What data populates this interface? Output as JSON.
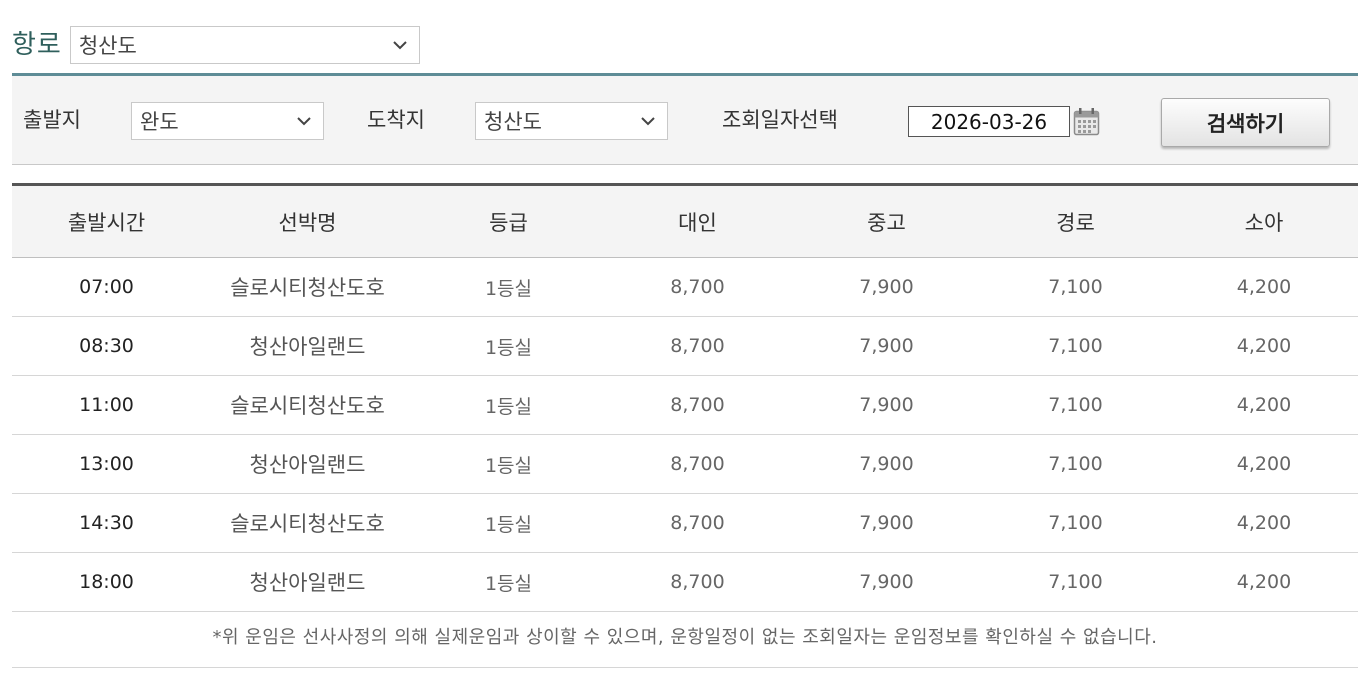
{
  "route": {
    "label": "항로",
    "selected": "청산도"
  },
  "search": {
    "departure_label": "출발지",
    "departure_value": "완도",
    "arrival_label": "도착지",
    "arrival_value": "청산도",
    "date_label": "조회일자선택",
    "date_value": "2026-03-26",
    "button_label": "검색하기"
  },
  "table": {
    "headers": [
      "출발시간",
      "선박명",
      "등급",
      "대인",
      "중고",
      "경로",
      "소아"
    ],
    "rows": [
      [
        "07:00",
        "슬로시티청산도호",
        "1등실",
        "8,700",
        "7,900",
        "7,100",
        "4,200"
      ],
      [
        "08:30",
        "청산아일랜드",
        "1등실",
        "8,700",
        "7,900",
        "7,100",
        "4,200"
      ],
      [
        "11:00",
        "슬로시티청산도호",
        "1등실",
        "8,700",
        "7,900",
        "7,100",
        "4,200"
      ],
      [
        "13:00",
        "청산아일랜드",
        "1등실",
        "8,700",
        "7,900",
        "7,100",
        "4,200"
      ],
      [
        "14:30",
        "슬로시티청산도호",
        "1등실",
        "8,700",
        "7,900",
        "7,100",
        "4,200"
      ],
      [
        "18:00",
        "청산아일랜드",
        "1등실",
        "8,700",
        "7,900",
        "7,100",
        "4,200"
      ]
    ]
  },
  "notice": "*위 운임은 선사사정의 의해 실제운임과 상이할 수 있으며, 운항일정이 없는 조회일자는 운임정보를 확인하실 수 없습니다.",
  "colors": {
    "route_label": "#2f5f5c",
    "search_box_border": "#5e8c96",
    "table_header_bg": "#f4f4f4"
  },
  "icons": {
    "dropdown": "chevron-down-icon",
    "calendar": "calendar-icon"
  }
}
